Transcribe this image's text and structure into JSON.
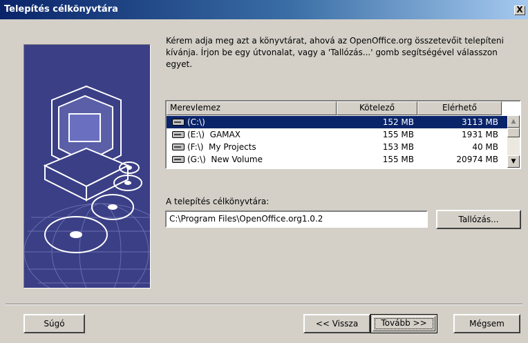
{
  "window": {
    "title": "Telepítés célkönyvtára",
    "close_label": "X"
  },
  "instructions": "Kérem adja meg azt a könyvtárat, ahová az OpenOffice.org összetevőit telepíteni kívánja. Írjon be egy útvonalat, vagy a 'Tallózás...' gomb segítségével válasszon egyet.",
  "drive_list": {
    "columns": [
      "Merevlemez",
      "Kötelező",
      "Elérhető"
    ],
    "rows": [
      {
        "drive": "(C:\\)",
        "required": "152 MB",
        "available": "3113 MB",
        "selected": true
      },
      {
        "drive": "(E:\\)  GAMAX",
        "required": "155 MB",
        "available": "1931 MB",
        "selected": false
      },
      {
        "drive": "(F:\\)  My Projects",
        "required": "153 MB",
        "available": "40 MB",
        "selected": false
      },
      {
        "drive": "(G:\\)  New Volume",
        "required": "155 MB",
        "available": "20974 MB",
        "selected": false
      }
    ]
  },
  "install_path": {
    "label": "A telepítés célkönyvtára:",
    "value": "C:\\Program Files\\OpenOffice.org1.0.2"
  },
  "buttons": {
    "browse": "Tallózás...",
    "help": "Súgó",
    "back": "<< Vissza",
    "next": "Tovább >>",
    "cancel": "Mégsem"
  },
  "icons": {
    "close": "close-icon",
    "drive": "hard-drive-icon",
    "scroll_up": "scroll-up-icon",
    "scroll_down": "scroll-down-icon"
  },
  "colors": {
    "title_bar": "#0a246a",
    "selection": "#0a246a",
    "dialog_bg": "#d4d0c8",
    "illustration_bg": "#3b3f86"
  }
}
